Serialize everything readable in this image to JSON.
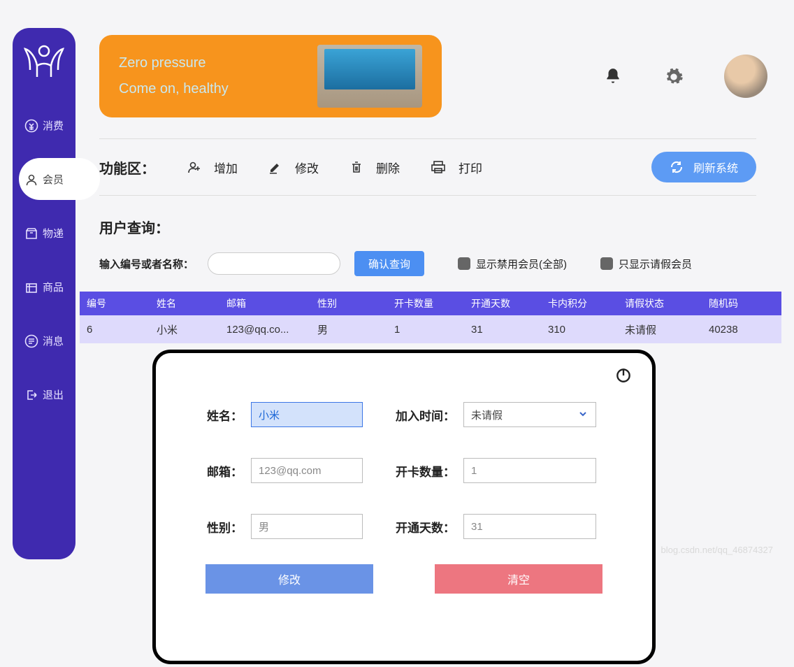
{
  "banner": {
    "line1": "Zero pressure",
    "line2": "Come on, healthy"
  },
  "sidebar": {
    "items": [
      {
        "label": "消费",
        "icon": "yen-icon"
      },
      {
        "label": "会员",
        "icon": "user-icon",
        "active": true
      },
      {
        "label": "物递",
        "icon": "box-icon"
      },
      {
        "label": "商品",
        "icon": "goods-icon"
      },
      {
        "label": "消息",
        "icon": "message-icon"
      },
      {
        "label": "退出",
        "icon": "logout-icon"
      }
    ]
  },
  "function_row": {
    "title": "功能区：",
    "add": "增加",
    "edit": "修改",
    "delete": "删除",
    "print": "打印",
    "refresh": "刷新系统"
  },
  "query": {
    "title": "用户查询：",
    "input_label": "输入编号或者名称：",
    "confirm": "确认查询",
    "show_disabled": "显示禁用会员(全部)",
    "show_leave": "只显示请假会员"
  },
  "table": {
    "headers": [
      "编号",
      "姓名",
      "邮箱",
      "性别",
      "开卡数量",
      "开通天数",
      "卡内积分",
      "请假状态",
      "随机码"
    ],
    "rows": [
      {
        "id": "6",
        "name": "小米",
        "email": "123@qq.co...",
        "gender": "男",
        "cards": "1",
        "days": "31",
        "points": "310",
        "leave": "未请假",
        "rand": "40238"
      }
    ]
  },
  "modal": {
    "name_label": "姓名：",
    "name_value": "小米",
    "join_label": "加入时间：",
    "join_value": "未请假",
    "email_label": "邮箱：",
    "email_value": "123@qq.com",
    "cards_label": "开卡数量：",
    "cards_value": "1",
    "gender_label": "性别：",
    "gender_value": "男",
    "days_label": "开通天数：",
    "days_value": "31",
    "modify": "修改",
    "clear": "清空"
  },
  "watermark": "blog.csdn.net/qq_46874327"
}
